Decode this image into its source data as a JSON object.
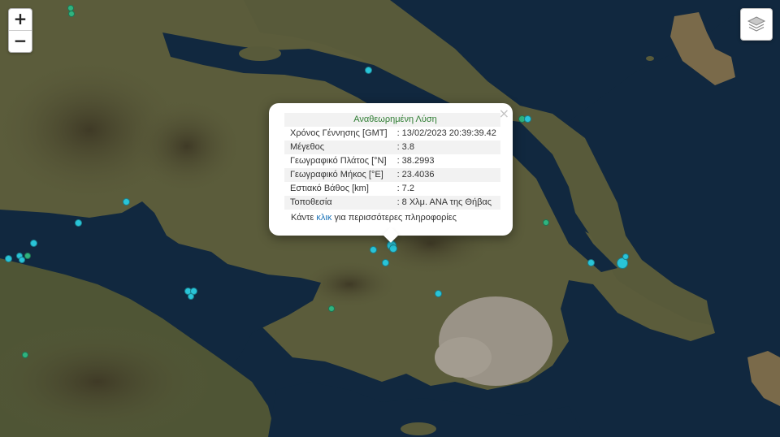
{
  "controls": {
    "zoom_in": "+",
    "zoom_out": "−"
  },
  "popup": {
    "title": "Αναθεωρημένη Λύση",
    "close": "×",
    "rows": [
      {
        "label": "Χρόνος Γέννησης [GMT]",
        "value": ": 13/02/2023 20:39:39.42"
      },
      {
        "label": "Μέγεθος",
        "value": ": 3.8"
      },
      {
        "label": "Γεωγραφικό Πλάτος [°N]",
        "value": ": 38.2993"
      },
      {
        "label": "Γεωγραφικό Μήκος [°E]",
        "value": ": 23.4036"
      },
      {
        "label": "Εστιακό Βάθος [km]",
        "value": ": 7.2"
      },
      {
        "label": "Τοποθεσία",
        "value": ": 8 Χλμ. ΑΝΑ της Θήβας"
      }
    ],
    "more_prefix": "Κάντε ",
    "more_link": "κλικ",
    "more_suffix": " για περισσότερες πληροφορίες"
  },
  "colors": {
    "sea": "#11283f",
    "land": "#5b5c3b",
    "quake_cyan": "#29c4d8",
    "quake_green": "#2fb37f"
  },
  "icons": {
    "zoom_in": "plus-icon",
    "zoom_out": "minus-icon",
    "layers": "layers-icon",
    "close": "close-icon",
    "marker": "circle-marker"
  }
}
